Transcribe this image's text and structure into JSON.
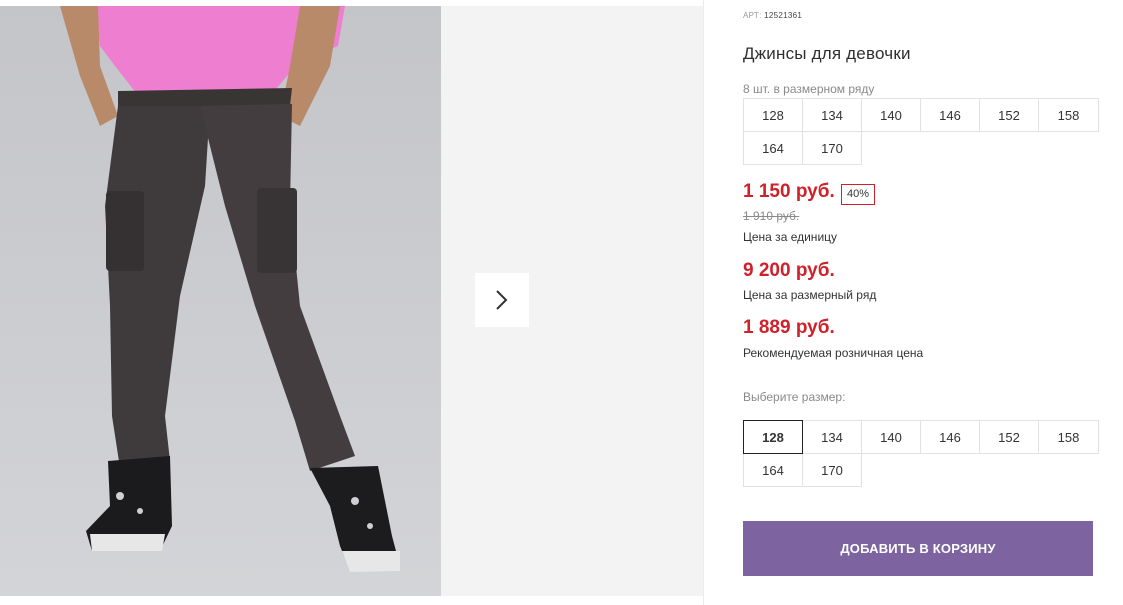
{
  "product": {
    "art_label": "АРТ:",
    "art_number": "12521361",
    "title": "Джинсы для девочки",
    "pack_caption": "8 шт. в размерном ряду",
    "pack_sizes": [
      "128",
      "134",
      "140",
      "146",
      "152",
      "158",
      "164",
      "170"
    ]
  },
  "pricing": {
    "unit_price": "1 150 руб.",
    "discount": "40%",
    "old_price": "1 910 руб.",
    "unit_label": "Цена за единицу",
    "row_price": "9 200 руб.",
    "row_label": "Цена за размерный ряд",
    "retail_price": "1 889 руб.",
    "retail_label": "Рекомендуемая розничная цена",
    "accent_color": "#d0212a"
  },
  "size_picker": {
    "caption": "Выберите размер:",
    "sizes": [
      "128",
      "134",
      "140",
      "146",
      "152",
      "158",
      "164",
      "170"
    ],
    "selected": "128"
  },
  "actions": {
    "add_to_cart": "ДОБАВИТЬ В КОРЗИНУ",
    "button_color": "#7d64a1"
  },
  "gallery": {
    "next_icon": "chevron-right-icon"
  }
}
